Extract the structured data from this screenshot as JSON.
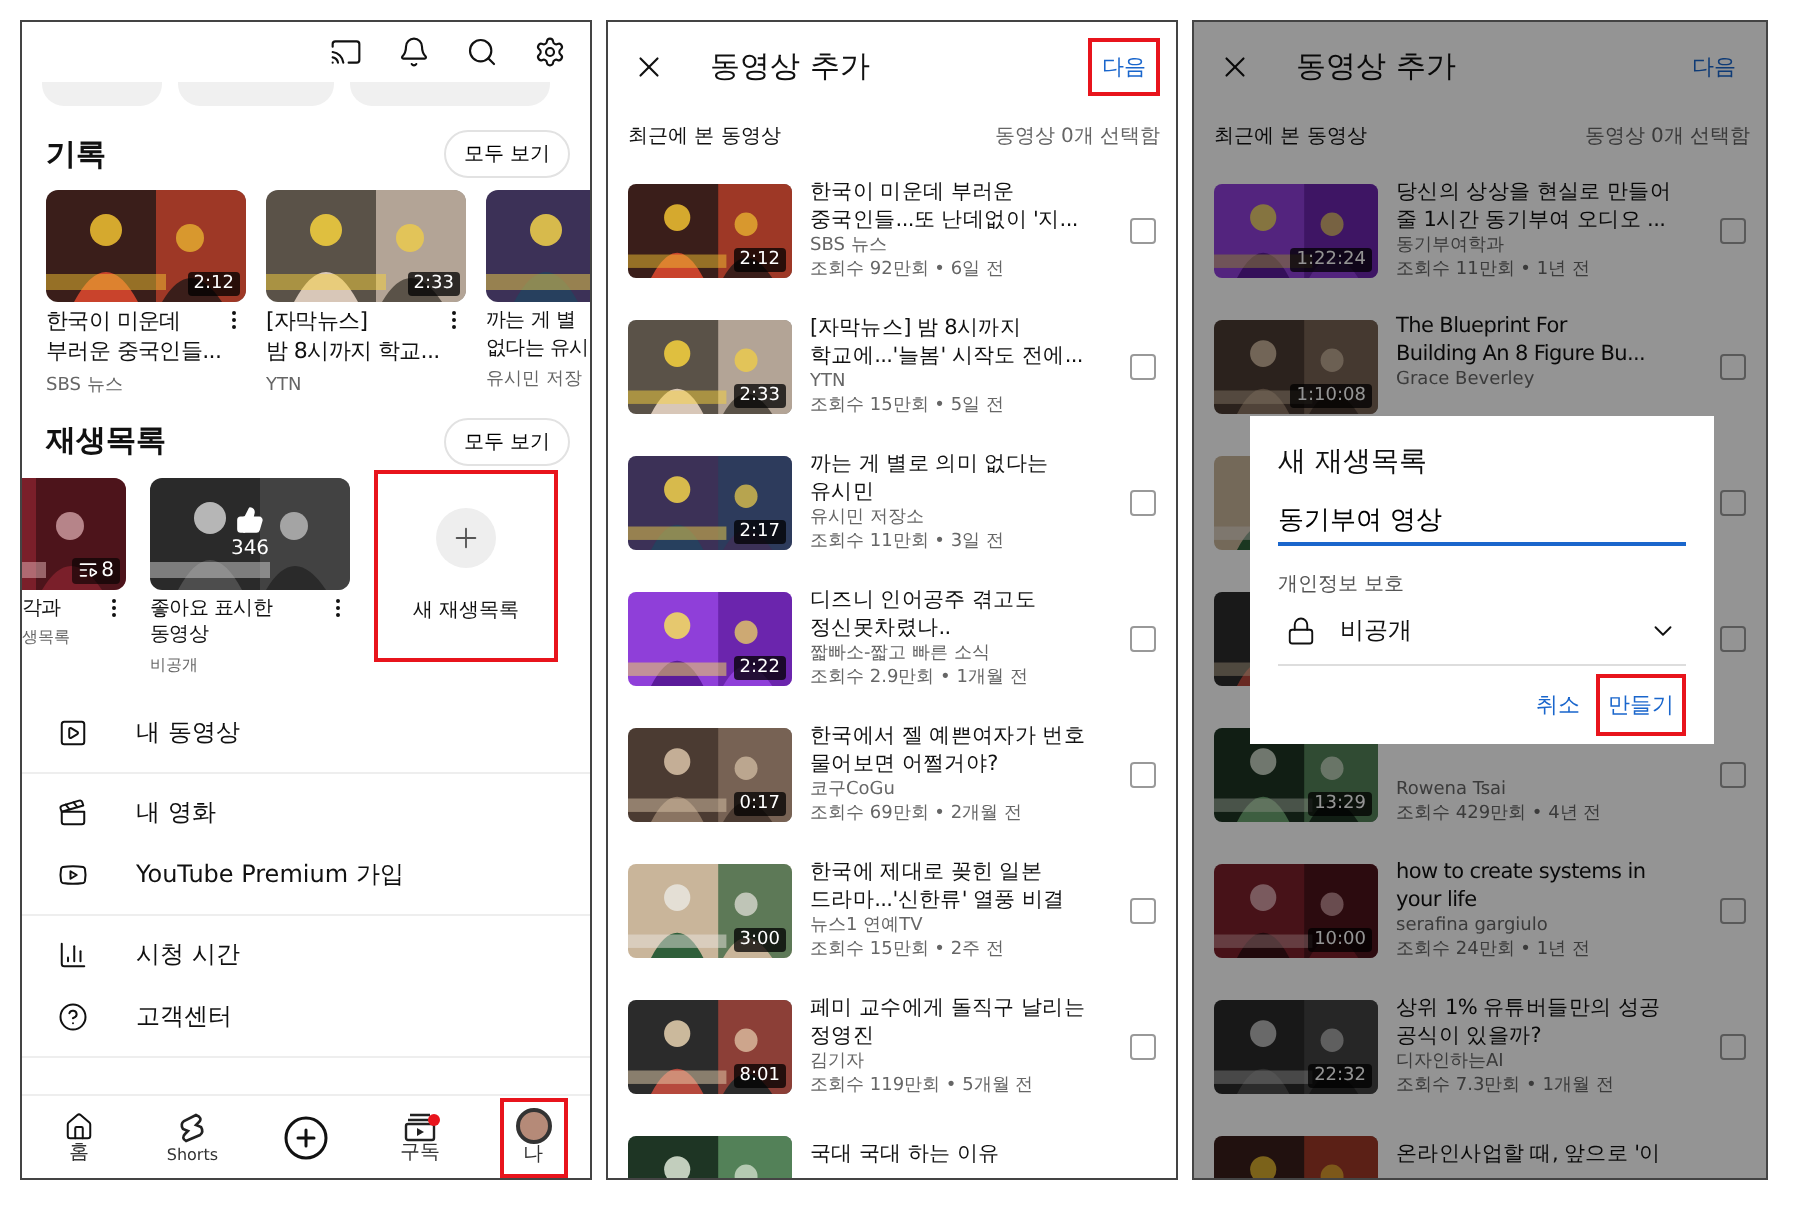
{
  "library_screen": {
    "history": {
      "title": "기록",
      "see_all": "모두 보기",
      "videos": [
        {
          "title_lines": [
            "한국이 미운데",
            "부러운 중국인들..."
          ],
          "channel": "SBS 뉴스",
          "duration": "2:12"
        },
        {
          "title_lines": [
            "[자막뉴스]",
            "밤 8시까지 학교..."
          ],
          "channel": "YTN",
          "duration": "2:33"
        },
        {
          "title_lines": [
            "까는 게 별",
            "없다는 유시"
          ],
          "channel": "유시민 저장"
        }
      ]
    },
    "playlists": {
      "title": "재생목록",
      "see_all": "모두 보기",
      "items": [
        {
          "kind": "playlist",
          "title_lines": [
            "각과"
          ],
          "subtitle": "생목록",
          "count": "8"
        },
        {
          "kind": "liked",
          "title_lines": [
            "좋아요 표시한",
            "동영상"
          ],
          "subtitle": "비공개",
          "count": "346"
        },
        {
          "kind": "new",
          "label": "새 재생목록",
          "highlighted": true
        }
      ]
    },
    "menu_sections": [
      [
        {
          "kind": "video",
          "label": "내 동영상"
        }
      ],
      [
        {
          "kind": "movie",
          "label": "내 영화"
        },
        {
          "kind": "premium",
          "label": "YouTube Premium 가입"
        }
      ],
      [
        {
          "kind": "time",
          "label": "시청 시간"
        },
        {
          "kind": "help",
          "label": "고객센터"
        }
      ]
    ],
    "nav": [
      {
        "kind": "home",
        "label": "홈",
        "highlighted": false,
        "badge": false
      },
      {
        "kind": "shorts",
        "label": "Shorts",
        "highlighted": false,
        "badge": false
      },
      {
        "kind": "create",
        "highlighted": false,
        "badge": false
      },
      {
        "kind": "subscriptions",
        "label": "구독",
        "highlighted": false,
        "badge": true
      },
      {
        "kind": "avatar",
        "label": "나",
        "highlighted": true,
        "badge": false
      }
    ]
  },
  "add_videos_screen": {
    "title": "동영상 추가",
    "next": {
      "label": "다음",
      "highlighted": true
    },
    "section": "최근에 본 동영상",
    "selected_count": "동영상 0개 선택함",
    "videos": [
      {
        "title_lines": [
          "한국이 미운데 부러운",
          "중국인들...또 난데없이 '지..."
        ],
        "channel": "SBS 뉴스",
        "meta": "조회수 92만회 • 6일 전",
        "duration": "2:12",
        "checked": false
      },
      {
        "title_lines": [
          "[자막뉴스] 밤 8시까지",
          "학교에...'늘봄' 시작도 전에..."
        ],
        "channel": "YTN",
        "meta": "조회수 15만회 • 5일 전",
        "duration": "2:33",
        "checked": false
      },
      {
        "title_lines": [
          "까는 게 별로 의미 없다는",
          "유시민"
        ],
        "channel": "유시민 저장소",
        "meta": "조회수 11만회 • 3일 전",
        "duration": "2:17",
        "checked": false
      },
      {
        "title_lines": [
          "디즈니 인어공주 겪고도",
          "정신못차렸나.."
        ],
        "channel": "짧빠소-짧고 빠른 소식",
        "meta": "조회수 2.9만회 • 1개월 전",
        "duration": "2:22",
        "checked": false
      },
      {
        "title_lines": [
          "한국에서 젤 예쁜여자가 번호",
          "물어보면 어쩔거야?"
        ],
        "channel": "코구CoGu",
        "meta": "조회수 69만회 • 2개월 전",
        "duration": "0:17",
        "checked": false
      },
      {
        "title_lines": [
          "한국에 제대로 꽂힌 일본",
          "드라마...'신한류' 열풍 비결"
        ],
        "channel": "뉴스1 연예TV",
        "meta": "조회수 15만회 • 2주 전",
        "duration": "3:00",
        "checked": false
      },
      {
        "title_lines": [
          "페미 교수에게 돌직구 날리는",
          "정영진"
        ],
        "channel": "김기자",
        "meta": "조회수 119만회 • 5개월 전",
        "duration": "8:01",
        "checked": false
      },
      {
        "title_lines": [
          "국대 국대 하는 이유"
        ]
      }
    ]
  },
  "new_playlist_screen": {
    "title": "동영상 추가",
    "next": {
      "label": "다음",
      "highlighted": false
    },
    "section": "최근에 본 동영상",
    "selected_count": "동영상 0개 선택함",
    "videos": [
      {
        "title_lines": [
          "당신의 상상을 현실로 만들어",
          "줄 1시간 동기부여 오디오 ..."
        ],
        "channel": "동기부여학과",
        "meta": "조회수 11만회 • 1년 전",
        "duration": "1:22:24",
        "checked": false
      },
      {
        "title_lines": [
          "The Blueprint For",
          "Building An 8 Figure Bu..."
        ],
        "channel": "Grace Beverley",
        "duration": "1:10:08",
        "checked": false
      },
      {
        "checked": false
      },
      {
        "checked": false
      },
      {
        "channel": "Rowena Tsai",
        "meta": "조회수 429만회 • 4년 전",
        "duration": "13:29",
        "checked": false
      },
      {
        "title_lines": [
          "how to create systems in",
          "your life"
        ],
        "channel": "serafina gargiulo",
        "meta": "조회수 24만회 • 1년 전",
        "duration": "10:00",
        "checked": false
      },
      {
        "title_lines": [
          "상위 1% 유튜버들만의 성공",
          "공식이 있을까?"
        ],
        "channel": "디자인하는AI",
        "meta": "조회수 7.3만회 • 1개월 전",
        "duration": "22:32",
        "checked": false
      },
      {
        "title_lines": [
          "온라인사업할 때, 앞으로 '이"
        ]
      }
    ],
    "dialog": {
      "title": "새 재생목록",
      "name_value": "동기부여 영상",
      "privacy_label": "개인정보 보호",
      "privacy_value": "비공개",
      "cancel": "취소",
      "create": {
        "label": "만들기",
        "highlighted": true
      }
    }
  }
}
